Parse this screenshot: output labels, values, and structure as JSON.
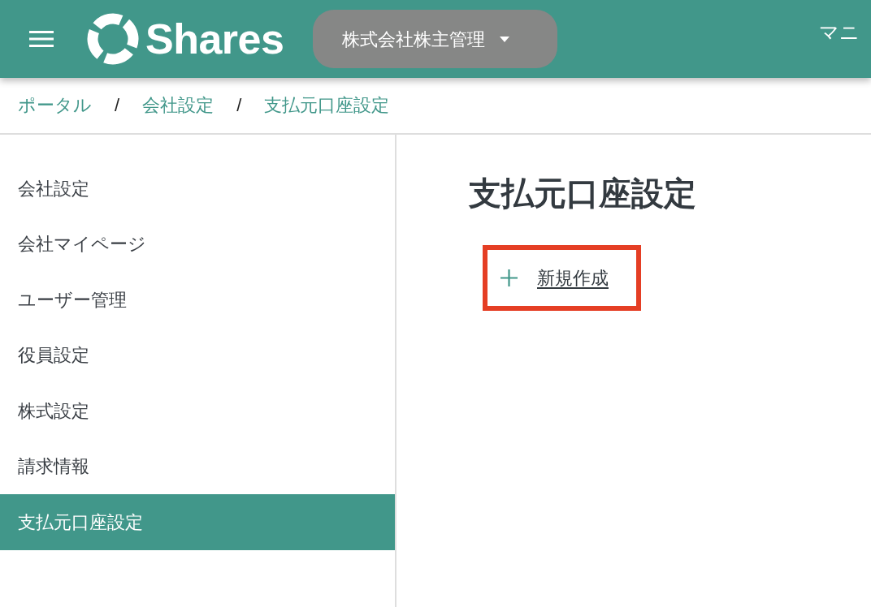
{
  "header": {
    "logo_text": "Shares",
    "company_menu": {
      "label": "株式会社株主管理"
    },
    "right_link": "マニ"
  },
  "breadcrumb": {
    "items": [
      {
        "label": "ポータル"
      },
      {
        "label": "会社設定"
      },
      {
        "label": "支払元口座設定"
      }
    ],
    "separators": [
      "/",
      "/"
    ]
  },
  "sidebar": {
    "items": [
      {
        "label": "会社設定",
        "selected": false
      },
      {
        "label": "会社マイページ",
        "selected": false
      },
      {
        "label": "ユーザー管理",
        "selected": false
      },
      {
        "label": "役員設定",
        "selected": false
      },
      {
        "label": "株式設定",
        "selected": false
      },
      {
        "label": "請求情報",
        "selected": false
      },
      {
        "label": "支払元口座設定",
        "selected": true
      }
    ]
  },
  "main": {
    "title": "支払元口座設定",
    "create_link": {
      "label": "新規作成",
      "highlighted": true
    }
  }
}
